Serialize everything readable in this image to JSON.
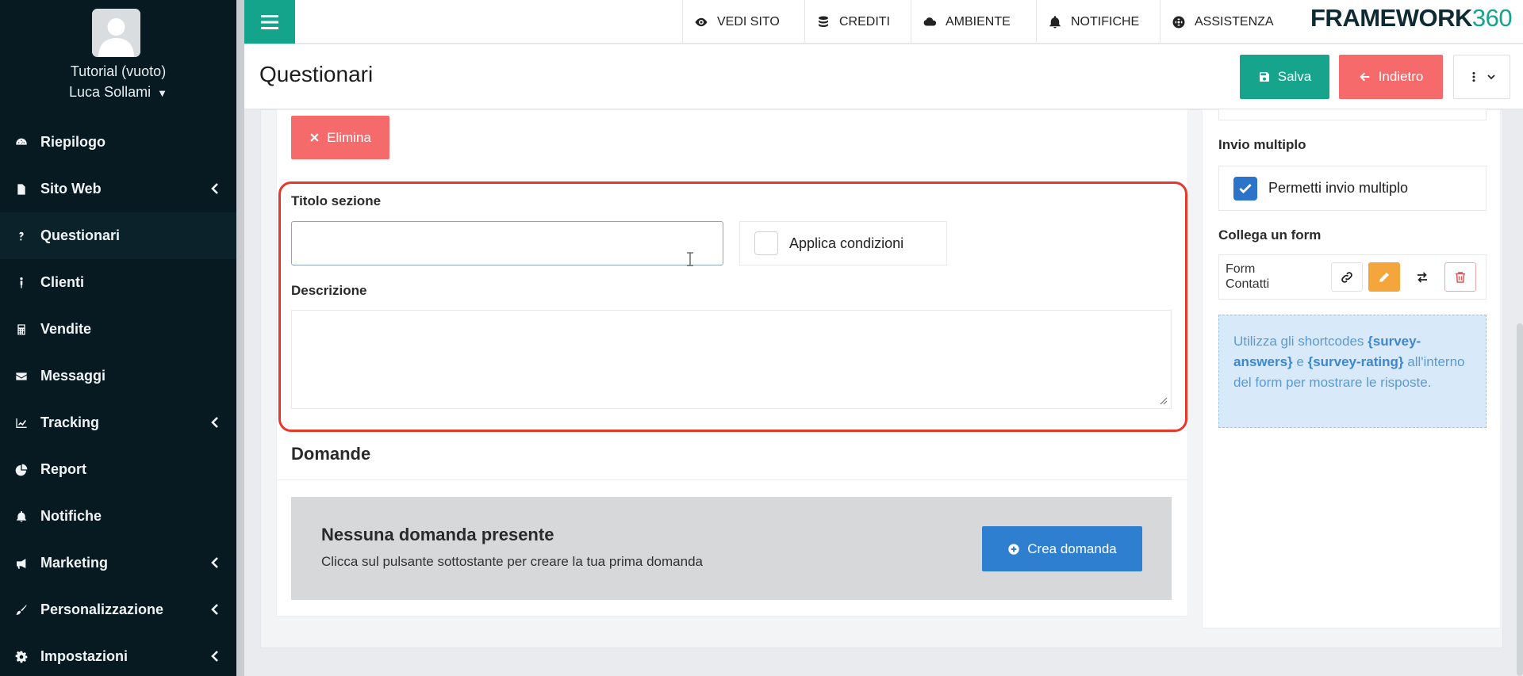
{
  "user": {
    "org": "Tutorial (vuoto)",
    "name": "Luca Sollami"
  },
  "sidebar": {
    "items": [
      {
        "label": "Riepilogo",
        "icon": "dashboard-icon",
        "chevron": false,
        "active": false
      },
      {
        "label": "Sito Web",
        "icon": "file-icon",
        "chevron": true,
        "active": false
      },
      {
        "label": "Questionari",
        "icon": "question-icon",
        "chevron": false,
        "active": true
      },
      {
        "label": "Clienti",
        "icon": "user-icon",
        "chevron": false,
        "active": false
      },
      {
        "label": "Vendite",
        "icon": "calculator-icon",
        "chevron": false,
        "active": false
      },
      {
        "label": "Messaggi",
        "icon": "envelope-icon",
        "chevron": false,
        "active": false
      },
      {
        "label": "Tracking",
        "icon": "chart-line-icon",
        "chevron": true,
        "active": false
      },
      {
        "label": "Report",
        "icon": "pie-chart-icon",
        "chevron": false,
        "active": false
      },
      {
        "label": "Notifiche",
        "icon": "bell-icon",
        "chevron": false,
        "active": false
      },
      {
        "label": "Marketing",
        "icon": "megaphone-icon",
        "chevron": true,
        "active": false
      },
      {
        "label": "Personalizzazione",
        "icon": "brush-icon",
        "chevron": true,
        "active": false
      },
      {
        "label": "Impostazioni",
        "icon": "gear-icon",
        "chevron": true,
        "active": false
      }
    ]
  },
  "topbar": {
    "vedi_sito": "VEDI SITO",
    "crediti": "CREDITI",
    "ambiente": "AMBIENTE",
    "notifiche": "NOTIFICHE",
    "assistenza": "ASSISTENZA",
    "brand_word": "FRAMEWORK",
    "brand_num": "360"
  },
  "header": {
    "title": "Questionari",
    "save_label": "Salva",
    "back_label": "Indietro"
  },
  "section": {
    "delete_label": "Elimina",
    "title_label": "Titolo sezione",
    "title_value": "",
    "conditions_label": "Applica condizioni",
    "description_label": "Descrizione",
    "description_value": ""
  },
  "questions": {
    "heading": "Domande",
    "empty_title": "Nessuna domanda presente",
    "empty_subtitle": "Clicca sul pulsante sottostante per creare la tua prima domanda",
    "create_label": "Crea domanda"
  },
  "settings": {
    "multi_heading": "Invio multiplo",
    "multi_label": "Permetti invio multiplo",
    "multi_checked": true,
    "form_heading": "Collega un form",
    "form_name": "Form Contatti",
    "info_pre": "Utilizza gli shortcodes ",
    "info_code1": "{survey-answers}",
    "info_mid": " e ",
    "info_code2": "{survey-rating}",
    "info_post": " all'interno del form per mostrare le risposte."
  },
  "colors": {
    "sidebar_bg": "#071a22",
    "accent_teal": "#14a38b",
    "danger": "#f56b6c",
    "primary_blue": "#2f7fd0",
    "warning": "#f4a53c",
    "highlight_red": "#e8382a"
  }
}
